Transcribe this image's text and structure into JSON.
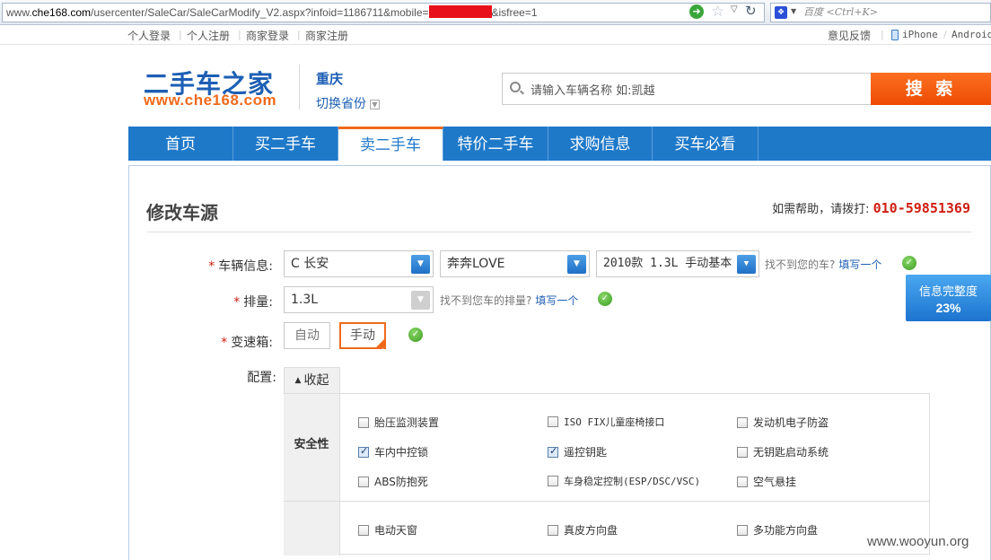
{
  "browser": {
    "url_prefix": "www.",
    "url_domain": "che168.com",
    "url_path": "/usercenter/SaleCar/SaleCarModify_V2.aspx?infoid=1186711&mobile=",
    "url_suffix": "&isfree=1",
    "search_placeholder": "百度 <Ctrl+K>",
    "search_engine_icon": "baidu-paw-icon"
  },
  "top_links": {
    "login": "个人登录",
    "register": "个人注册",
    "dealer_login": "商家登录",
    "dealer_register": "商家注册",
    "feedback": "意见反馈",
    "iphone": "iPhone",
    "android": "Android"
  },
  "header": {
    "logo_cn": "二手车之家",
    "logo_en": "www.che168.com",
    "city": "重庆",
    "switch_province": "切换省份",
    "search_placeholder": "请输入车辆名称 如:凯越",
    "search_button": "搜 索"
  },
  "nav": [
    {
      "label": "首页"
    },
    {
      "label": "买二手车"
    },
    {
      "label": "卖二手车"
    },
    {
      "label": "特价二手车"
    },
    {
      "label": "求购信息"
    },
    {
      "label": "买车必看"
    }
  ],
  "page": {
    "title": "修改车源",
    "help_text": "如需帮助，请拨打:",
    "help_phone": "010-59851369"
  },
  "form": {
    "vehicle_label": "车辆信息:",
    "brand": "C 长安",
    "series": "奔奔LOVE",
    "model": "2010款 1.3L 手动基本",
    "vehicle_hint": "找不到您的车?",
    "vehicle_hint_link": "填写一个",
    "displacement_label": "排量:",
    "displacement": "1.3L",
    "displacement_hint": "找不到您车的排量?",
    "displacement_hint_link": "填写一个",
    "gearbox_label": "变速箱:",
    "gearbox_auto": "自动",
    "gearbox_manual": "手动",
    "gearbox_selected": "手动",
    "config_label": "配置:",
    "collapse_label": "收起",
    "required_mark": "*"
  },
  "completeness": {
    "label": "信息完整度",
    "value": "23%"
  },
  "config": {
    "safety_label": "安全性",
    "safety_items": [
      {
        "label": "胎压监测装置",
        "checked": false
      },
      {
        "label": "ISO FIX儿童座椅接口",
        "checked": false
      },
      {
        "label": "发动机电子防盗",
        "checked": false
      },
      {
        "label": "车内中控锁",
        "checked": true
      },
      {
        "label": "遥控钥匙",
        "checked": true
      },
      {
        "label": "无钥匙启动系统",
        "checked": false
      },
      {
        "label": "ABS防抱死",
        "checked": false
      },
      {
        "label": "车身稳定控制(ESP/DSC/VSC)",
        "checked": false
      },
      {
        "label": "空气悬挂",
        "checked": false
      }
    ],
    "comfort_items": [
      {
        "label": "电动天窗",
        "checked": false
      },
      {
        "label": "真皮方向盘",
        "checked": false
      },
      {
        "label": "多功能方向盘",
        "checked": false
      }
    ]
  },
  "watermark": "www.wooyun.org",
  "colors": {
    "brand_blue": "#1f79c9",
    "accent_orange": "#f06a1c",
    "phone_red": "#d01e12"
  }
}
